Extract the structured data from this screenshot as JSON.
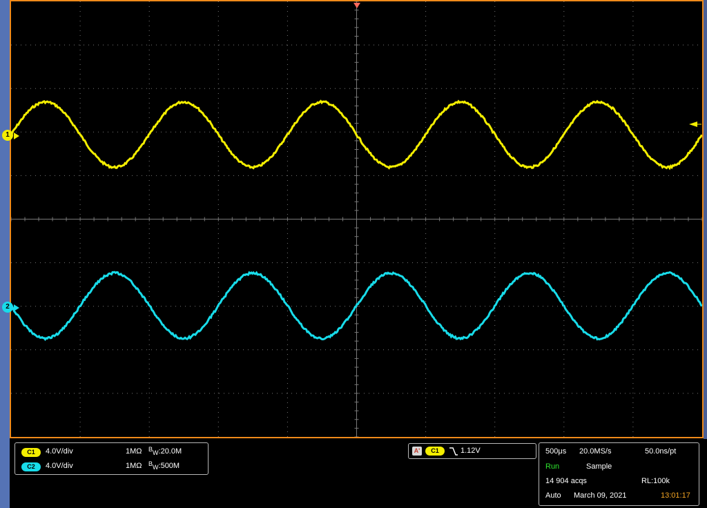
{
  "colors": {
    "frame": "#f08a1a",
    "ch1": "#f4ee00",
    "ch2": "#18dcea",
    "grid": "#7a7a7a",
    "trigger": "#ff6a5c"
  },
  "markers": {
    "ch1": "1",
    "ch2": "2"
  },
  "channels": [
    {
      "pill": "C1",
      "scale": "4.0V/div",
      "impedance": "1MΩ",
      "bw_prefix": "B",
      "bw_sub": "W",
      "bw_value": ":20.0M"
    },
    {
      "pill": "C2",
      "scale": "4.0V/div",
      "impedance": "1MΩ",
      "bw_prefix": "B",
      "bw_sub": "W",
      "bw_value": ":500M"
    }
  ],
  "trigger": {
    "type_icon": "A'",
    "source": "C1",
    "slope_icon": "falling-edge-icon",
    "level": "1.12V"
  },
  "acquisition": {
    "timebase": "500μs",
    "sample_rate": "20.0MS/s",
    "resolution": "50.0ns/pt",
    "state": "Run",
    "mode": "Sample",
    "acqs": "14 904 acqs",
    "record_length": "RL:100k",
    "trigger_mode": "Auto",
    "date": "March 09, 2021",
    "time": "13:01:17"
  },
  "waveforms": {
    "period_div": 2.0,
    "ch1": {
      "amplitude_div": 0.75,
      "offset_div": 0.0,
      "phase_deg": 0
    },
    "ch2": {
      "amplitude_div": 0.75,
      "offset_div": 0.0,
      "phase_deg": 180
    }
  }
}
